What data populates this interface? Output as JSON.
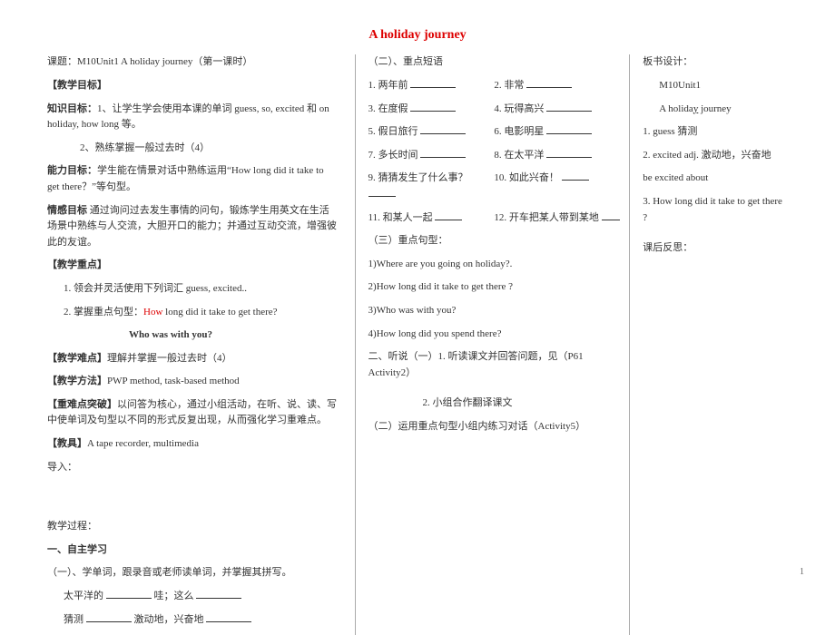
{
  "title": "A holiday journey",
  "left": {
    "lesson_label": "课题：M10Unit1  A holiday journey（第一课时）",
    "goal_heading": "【教学目标】",
    "goal_knowledge_label": "知识目标：",
    "goal_knowledge_1": "1、让学生学会使用本课的单词 guess, so, excited 和 on holiday, how long 等。",
    "goal_knowledge_2": "2、熟练掌握一般过去时（4）",
    "goal_ability_label": "能力目标：",
    "goal_ability_text": "学生能在情景对话中熟练运用“How long did it take to get there？”等句型。",
    "goal_emotion_label": "情感目标",
    "goal_emotion_text": " 通过询问过去发生事情的问句，锻炼学生用英文在生活场景中熟练与人交流，大胆开口的能力；并通过互动交流，增强彼此的友谊。",
    "keypoint_heading": "【教学重点】",
    "keypoint_1": "1. 领会并灵活使用下列词汇 guess, excited..",
    "keypoint_2_pre": "2. 掌握重点句型：",
    "keypoint_2_red": "How",
    "keypoint_2_post": " long did it take to get there?",
    "keypoint_2b": "Who was with you?",
    "difficulty_heading": "【教学难点】",
    "difficulty_text": "理解并掌握一般过去时（4）",
    "method_heading": "【教学方法】",
    "method_text": "PWP method, task-based method",
    "break_heading": "【重难点突破】",
    "break_text": "以问答为核心，通过小组活动，在听、说、读、写中使单词及句型以不同的形式反复出现，从而强化学习重难点。",
    "tool_heading": "【教具】",
    "tool_text": "A tape recorder, multimedia",
    "intro": "导入：",
    "process": "教学过程：",
    "self_study_heading": "一、自主学习",
    "self_study_1": "（一）、学单词，跟录音或老师读单词，并掌握其拼写。",
    "vocab_pacific": "太平洋的",
    "vocab_wow": "哇；这么",
    "vocab_guess": "猜测",
    "vocab_excited": "激动地，兴奋地"
  },
  "mid": {
    "sec2_heading": "（二）、重点短语",
    "p1a": "1. 两年前",
    "p1b": "2. 非常",
    "p2a": "3. 在度假",
    "p2b": "4. 玩得高兴",
    "p3a": "5. 假日旅行",
    "p3b": "6. 电影明星",
    "p4a": "7. 多长时间",
    "p4b": "8. 在太平洋",
    "p5a": "9. 猜猜发生了什么事？",
    "p5b": "10. 如此兴奋！",
    "p6a": "11. 和某人一起",
    "p6b": "12. 开车把某人带到某地",
    "sec3_heading": "（三）重点句型：",
    "q1": "1)Where are you going on holiday?.",
    "q2": "2)How long did it take to get there ?",
    "q3": "3)Who was with you?",
    "q4": "4)How long did you spend there?",
    "listen_heading": "二、听说（一）1. 听读课文并回答问题，见（P61 Activity2）",
    "listen_2": "2. 小组合作翻译课文",
    "listen_3": "（二）运用重点句型小组内练习对话（Activity5）"
  },
  "right": {
    "board_heading": "板书设计：",
    "board_unit": "M10Unit1",
    "board_title_pre": "A holida",
    "board_title_u": "y",
    "board_title_post": " journey",
    "board_1": "1. guess 猜测",
    "board_2": "2. excited adj. 激动地，兴奋地",
    "board_3": "be excited about",
    "board_4": "3. How long did it take to get there ?",
    "reflect_heading": "课后反思："
  },
  "page_number": "1"
}
